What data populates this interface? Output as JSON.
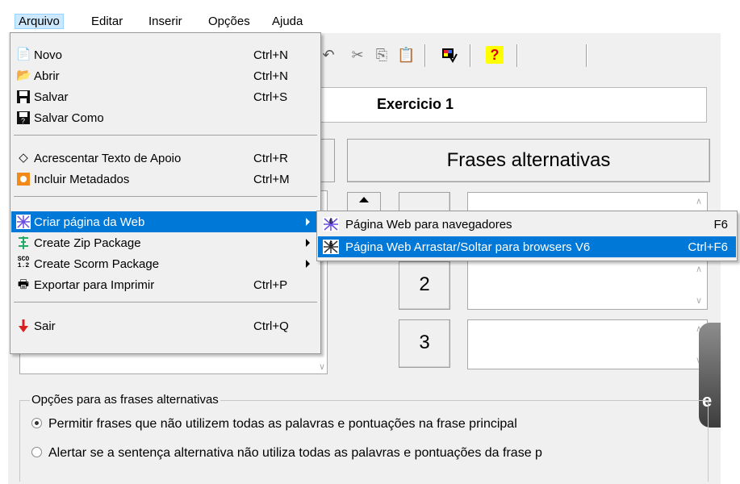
{
  "menubar": {
    "items": [
      "Arquivo",
      "Editar",
      "Inserir",
      "Opções",
      "Ajuda"
    ]
  },
  "toolbar": {
    "icons": [
      "undo-icon",
      "cut-icon",
      "copy-icon",
      "paste-icon",
      "check-icon",
      "help-icon"
    ],
    "help_glyph": "?"
  },
  "exercise": {
    "title": "Exercicio 1"
  },
  "frases": {
    "header": "Frases alternativas",
    "numbers": [
      "2",
      "3"
    ]
  },
  "options": {
    "legend": "Opções para as frases alternativas",
    "radio1": "Permitir frases que não utilizem todas as palavras e pontuações na frase principal",
    "radio2": "Alertar se a sentença alternativa não utiliza todas as palavras e pontuações da frase p",
    "selected": 1
  },
  "background_text": "e",
  "file_menu": {
    "items": [
      {
        "label": "Novo",
        "shortcut": "Ctrl+N",
        "icon": "new-document-icon"
      },
      {
        "label": "Abrir",
        "shortcut": "Ctrl+N",
        "icon": "open-folder-icon"
      },
      {
        "label": "Salvar",
        "shortcut": "Ctrl+S",
        "icon": "save-icon"
      },
      {
        "label": "Salvar Como",
        "shortcut": "",
        "icon": "save-as-icon"
      },
      {
        "label": "Acrescentar Texto de Apoio",
        "shortcut": "Ctrl+R",
        "icon": "tag-icon"
      },
      {
        "label": "Incluir Metadados",
        "shortcut": "Ctrl+M",
        "icon": "metadata-icon"
      },
      {
        "label": "Criar página da Web",
        "shortcut": "",
        "icon": "web-page-icon",
        "submenu": true,
        "highlighted": true
      },
      {
        "label": "Create Zip Package",
        "shortcut": "",
        "icon": "zip-icon",
        "submenu": true
      },
      {
        "label": "Create Scorm Package",
        "shortcut": "",
        "icon": "scorm-icon",
        "submenu": true
      },
      {
        "label": "Exportar para Imprimir",
        "shortcut": "Ctrl+P",
        "icon": "printer-icon"
      },
      {
        "label": "Sair",
        "shortcut": "Ctrl+Q",
        "icon": "exit-arrow-icon"
      }
    ],
    "scorm_badge": "SCO 1.2"
  },
  "web_submenu": {
    "items": [
      {
        "label": "Página Web para navegadores",
        "shortcut": "F6",
        "icon": "web-browser-icon"
      },
      {
        "label": "Página Web Arrastar/Soltar para browsers V6",
        "shortcut": "Ctrl+F6",
        "icon": "web-drag-drop-icon",
        "highlighted": true
      }
    ]
  },
  "colors": {
    "highlight": "#0078d7",
    "menu_bg": "#f0f0f0",
    "exit_arrow": "#d81e1e"
  }
}
